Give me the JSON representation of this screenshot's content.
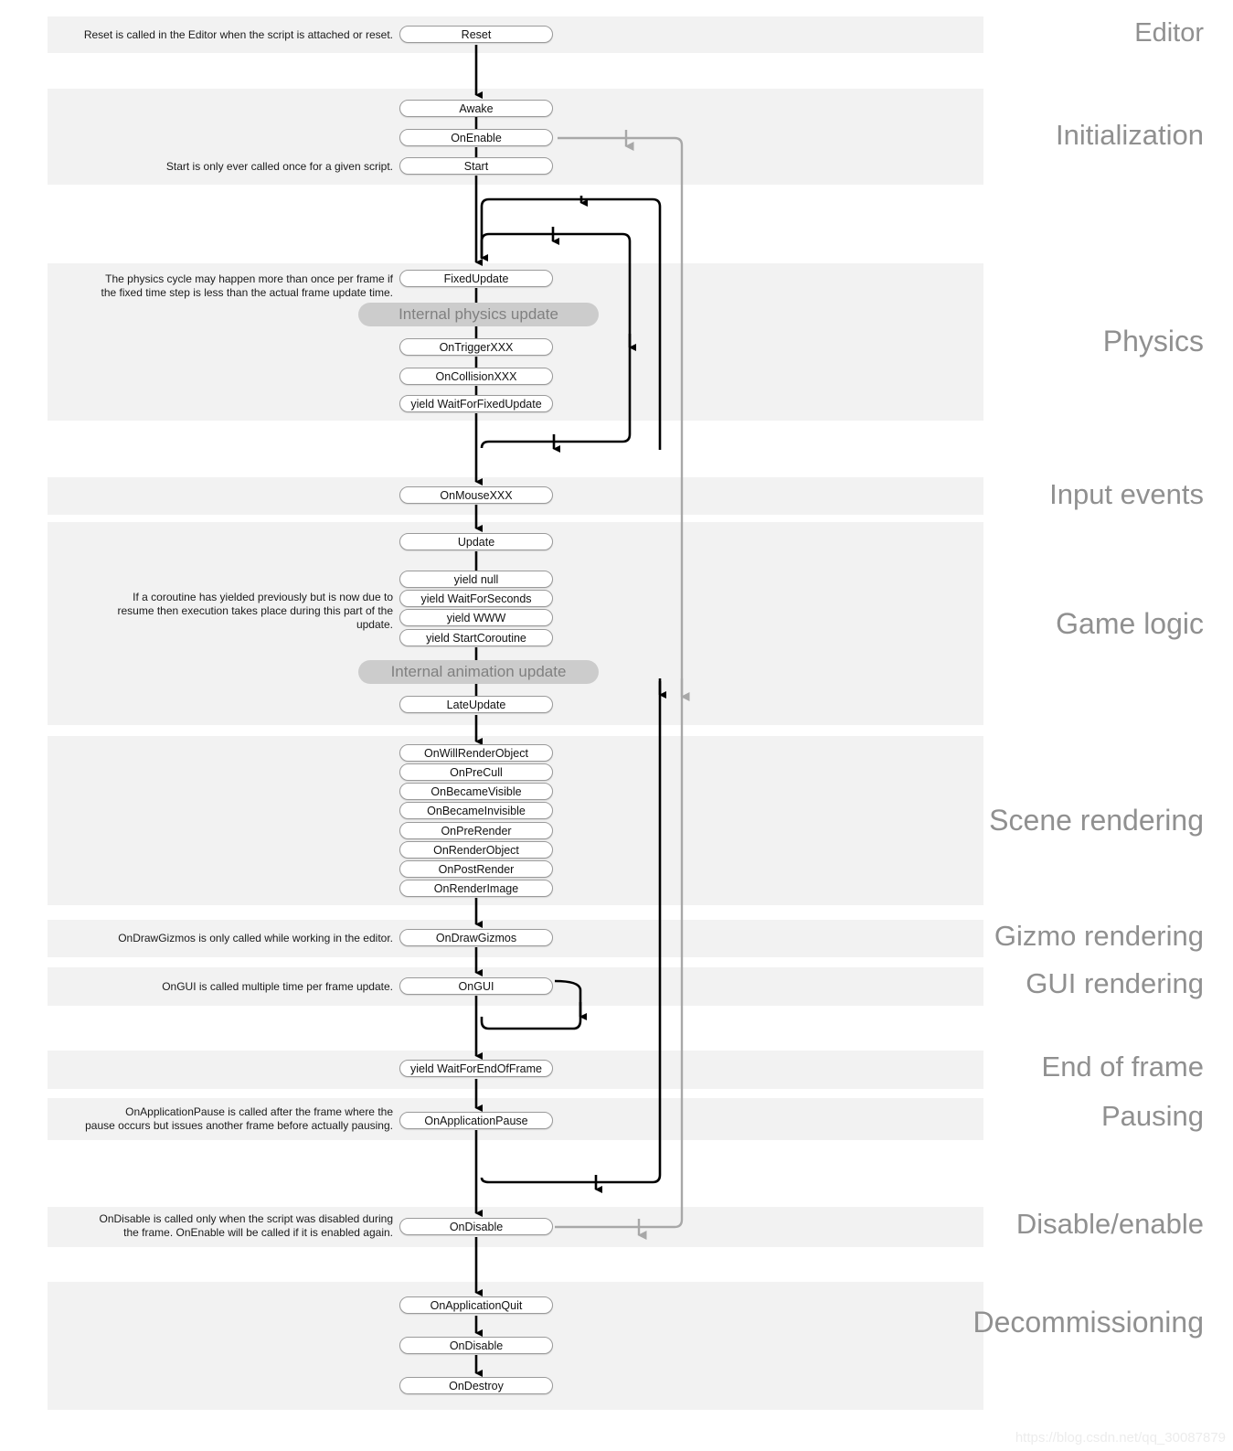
{
  "diagram": {
    "title": "Unity MonoBehaviour Script Lifecycle Flowchart",
    "watermark": "https://blog.csdn.net/qq_30087879",
    "colors": {
      "band_background": "#f2f2f2",
      "band_label": "#909090",
      "node_border": "#9a9a9a",
      "node_background": "#ffffff",
      "node_text": "#111111",
      "internal_pill_background": "#cccccc",
      "internal_pill_text": "#808080",
      "flow_arrow": "#000000",
      "enable_arrow": "#a8a8a8",
      "watermark": "#ececec"
    }
  },
  "sections": [
    {
      "id": "editor",
      "label": "Editor"
    },
    {
      "id": "initialization",
      "label": "Initialization"
    },
    {
      "id": "physics",
      "label": "Physics"
    },
    {
      "id": "input_events",
      "label": "Input events"
    },
    {
      "id": "game_logic",
      "label": "Game logic"
    },
    {
      "id": "scene_rendering",
      "label": "Scene rendering"
    },
    {
      "id": "gizmo_rendering",
      "label": "Gizmo rendering"
    },
    {
      "id": "gui_rendering",
      "label": "GUI rendering"
    },
    {
      "id": "end_of_frame",
      "label": "End of frame"
    },
    {
      "id": "pausing",
      "label": "Pausing"
    },
    {
      "id": "disable_enable",
      "label": "Disable/enable"
    },
    {
      "id": "decommissioning",
      "label": "Decommissioning"
    }
  ],
  "nodes": {
    "reset": "Reset",
    "awake": "Awake",
    "on_enable": "OnEnable",
    "start": "Start",
    "fixed_update": "FixedUpdate",
    "internal_physics_update": "Internal physics update",
    "on_trigger_xxx": "OnTriggerXXX",
    "on_collision_xxx": "OnCollisionXXX",
    "yield_wait_for_fixed_update": "yield WaitForFixedUpdate",
    "on_mouse_xxx": "OnMouseXXX",
    "update": "Update",
    "yield_null": "yield null",
    "yield_wait_for_seconds": "yield WaitForSeconds",
    "yield_www": "yield WWW",
    "yield_start_coroutine": "yield StartCoroutine",
    "internal_animation_update": "Internal animation update",
    "late_update": "LateUpdate",
    "on_will_render_object": "OnWillRenderObject",
    "on_pre_cull": "OnPreCull",
    "on_became_visible": "OnBecameVisible",
    "on_became_invisible": "OnBecameInvisible",
    "on_pre_render": "OnPreRender",
    "on_render_object": "OnRenderObject",
    "on_post_render": "OnPostRender",
    "on_render_image": "OnRenderImage",
    "on_draw_gizmos": "OnDrawGizmos",
    "on_gui": "OnGUI",
    "yield_wait_for_end_of_frame": "yield WaitForEndOfFrame",
    "on_application_pause": "OnApplicationPause",
    "on_disable": "OnDisable",
    "on_application_quit": "OnApplicationQuit",
    "on_disable_final": "OnDisable",
    "on_destroy": "OnDestroy"
  },
  "notes": {
    "reset": "Reset is called in the Editor when the script is attached or reset.",
    "start": "Start is only ever called once for a given script.",
    "physics": "The physics cycle may happen more than once per frame if\nthe fixed time step is less than the actual frame update time.",
    "coroutine": "If a coroutine has yielded previously but is now due to\nresume then execution takes place during this part of the\nupdate.",
    "gizmos": "OnDrawGizmos is only called while working in the editor.",
    "gui": "OnGUI is called multiple time per frame update.",
    "pause": "OnApplicationPause is called after the frame where the\npause occurs but issues another frame before actually pausing.",
    "disable": "OnDisable is called only when the script was disabled during\nthe frame. OnEnable will be called if it is enabled again."
  }
}
